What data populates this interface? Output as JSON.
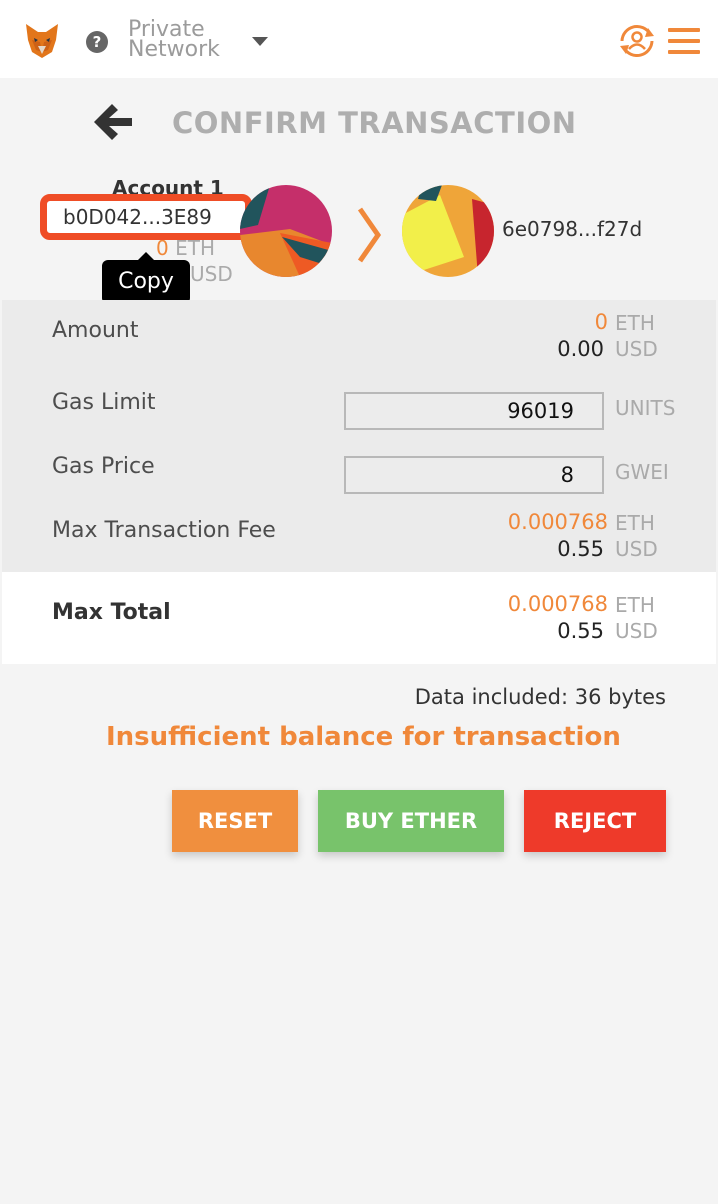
{
  "header": {
    "network_line1": "Private",
    "network_line2": "Network",
    "help_glyph": "?"
  },
  "page": {
    "title": "CONFIRM TRANSACTION"
  },
  "from_account": {
    "name": "Account 1",
    "address": "b0D042...3E89",
    "balance_eth_value": "0",
    "balance_eth_unit": "ETH",
    "balance_usd_unit": "USD",
    "tooltip": "Copy"
  },
  "to_account": {
    "address": "6e0798...f27d"
  },
  "details": {
    "amount_label": "Amount",
    "amount_eth": "0",
    "amount_eth_unit": "ETH",
    "amount_usd": "0.00",
    "amount_usd_unit": "USD",
    "gas_limit_label": "Gas Limit",
    "gas_limit_value": "96019",
    "gas_limit_unit": "UNITS",
    "gas_price_label": "Gas Price",
    "gas_price_value": "8",
    "gas_price_unit": "GWEI",
    "max_fee_label": "Max Transaction Fee",
    "max_fee_eth": "0.000768",
    "max_fee_eth_unit": "ETH",
    "max_fee_usd": "0.55",
    "max_fee_usd_unit": "USD"
  },
  "total": {
    "label": "Max Total",
    "eth": "0.000768",
    "eth_unit": "ETH",
    "usd": "0.55",
    "usd_unit": "USD"
  },
  "footer": {
    "data_included": "Data included: 36 bytes",
    "error": "Insufficient balance for transaction"
  },
  "buttons": {
    "reset": "RESET",
    "buy": "BUY ETHER",
    "reject": "REJECT"
  },
  "colors": {
    "accent": "#f0883a",
    "reject": "#ee3a2a",
    "buy": "#78c36b",
    "highlight": "#ef4d26"
  },
  "icons": [
    "metamask-fox-icon",
    "help-icon",
    "dropdown-caret-icon",
    "account-switch-icon",
    "hamburger-menu-icon",
    "back-arrow-icon",
    "account-identicon",
    "recipient-identicon",
    "chevron-right-icon"
  ]
}
